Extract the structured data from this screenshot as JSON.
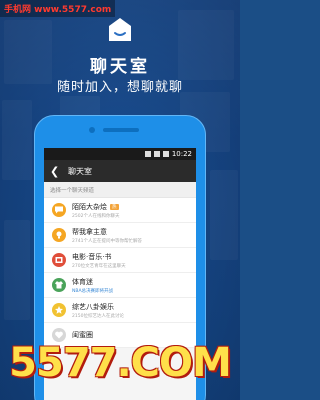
{
  "watermark_top": "手机网 www.5577.com",
  "watermark_bottom": "5577.COM",
  "promo": {
    "title": "聊天室",
    "subtitle": "随时加入，想聊就聊"
  },
  "status_bar": {
    "time": "10:22"
  },
  "app_bar": {
    "title": "聊天室"
  },
  "section_header": "选择一个聊天频道",
  "channels": [
    {
      "name": "陌陌大杂烩",
      "badge": "热",
      "desc": "2502个人在线和你聊天",
      "color": "#f5a623",
      "icon": "chat-bubble-icon"
    },
    {
      "name": "帮我拿主意",
      "badge": "",
      "desc": "2741个人正在提问中等你帮忙解答",
      "color": "#f5a623",
      "icon": "lightbulb-icon"
    },
    {
      "name": "电影·音乐·书",
      "badge": "",
      "desc": "270位文艺青年在这里聊天",
      "color": "#e04e3a",
      "icon": "film-icon"
    },
    {
      "name": "体育迷",
      "badge": "",
      "desc": "NBA总决赛即将开战",
      "desc_highlight": true,
      "color": "#4aa35a",
      "icon": "jersey-icon"
    },
    {
      "name": "综艺八卦娱乐",
      "badge": "",
      "desc": "2150位综艺达人在此讨论",
      "color": "#f1c232",
      "icon": "star-icon"
    },
    {
      "name": "闺蜜圈",
      "badge": "",
      "desc": "",
      "color": "#d7d7d7",
      "icon": "heart-icon"
    }
  ]
}
